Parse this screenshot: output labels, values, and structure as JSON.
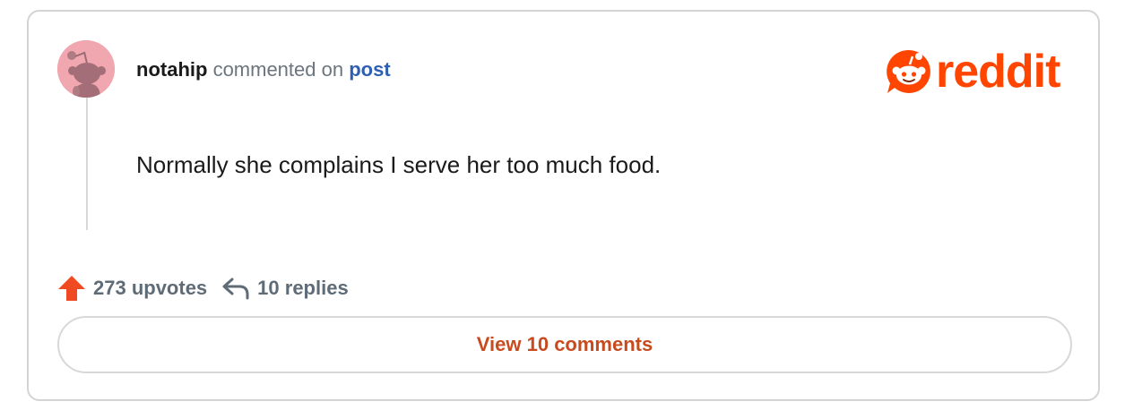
{
  "comment": {
    "username": "notahip",
    "action_text": "commented on",
    "post_link_label": "post",
    "body": "Normally she complains I serve her too much food.",
    "upvotes_label": "273 upvotes",
    "replies_label": "10 replies",
    "view_comments_label": "View 10 comments"
  },
  "brand": {
    "logo_text": "reddit",
    "logo_icon": "reddit-snoo-icon"
  },
  "icons": {
    "avatar": "snoo-avatar-icon",
    "upvote": "upvote-arrow-icon",
    "reply": "reply-arrow-icon"
  },
  "colors": {
    "brand_orange": "#ff4500",
    "upvote_orange": "#f04a23",
    "link_blue": "#2f5fb3",
    "button_text": "#c84a1f",
    "avatar_bg": "#f1a7b0",
    "muted_text": "#6c757d",
    "border": "#d4d4d4"
  }
}
